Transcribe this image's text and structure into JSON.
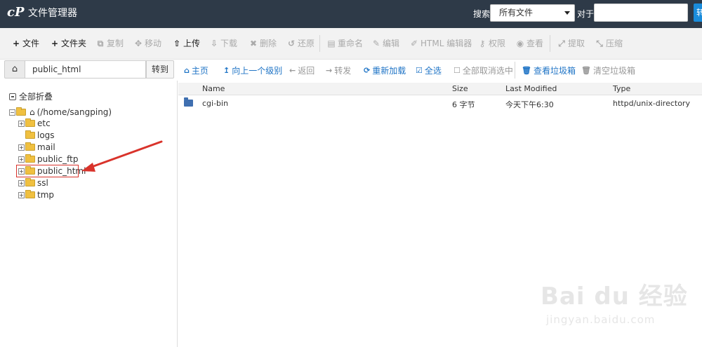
{
  "header": {
    "logo_text": "cP",
    "title": "文件管理器",
    "search_label": "搜索",
    "search_scope": "所有文件",
    "for_label": "对于",
    "search_value": "",
    "go_label": "转"
  },
  "toolbar": {
    "items": [
      {
        "label": "文件",
        "icon": "plus-icon",
        "enabled": true
      },
      {
        "label": "文件夹",
        "icon": "plus-icon",
        "enabled": true
      },
      {
        "label": "复制",
        "icon": "copy-icon",
        "enabled": false
      },
      {
        "label": "移动",
        "icon": "move-icon",
        "enabled": false
      },
      {
        "label": "上传",
        "icon": "upload-icon",
        "enabled": true
      },
      {
        "label": "下载",
        "icon": "download-icon",
        "enabled": false
      },
      {
        "label": "删除",
        "icon": "delete-icon",
        "enabled": false
      },
      {
        "label": "还原",
        "icon": "restore-icon",
        "enabled": false
      },
      {
        "label": "重命名",
        "icon": "rename-icon",
        "enabled": false
      },
      {
        "label": "编辑",
        "icon": "pencil-icon",
        "enabled": false
      },
      {
        "label": "HTML 编辑器",
        "icon": "html-editor-icon",
        "enabled": false
      },
      {
        "label": "权限",
        "icon": "key-icon",
        "enabled": false
      },
      {
        "label": "查看",
        "icon": "eye-icon",
        "enabled": false
      },
      {
        "label": "提取",
        "icon": "extract-icon",
        "enabled": false
      },
      {
        "label": "压缩",
        "icon": "compress-icon",
        "enabled": false
      }
    ]
  },
  "pathbar": {
    "path_value": "public_html",
    "goto_label": "转到"
  },
  "nav": {
    "items": [
      {
        "label": "主页",
        "icon": "home-icon",
        "enabled": true
      },
      {
        "label": "向上一个级别",
        "icon": "level-up-icon",
        "enabled": true
      },
      {
        "label": "返回",
        "icon": "back-icon",
        "enabled": false
      },
      {
        "label": "转发",
        "icon": "forward-icon",
        "enabled": false
      },
      {
        "label": "重新加载",
        "icon": "reload-icon",
        "enabled": true
      },
      {
        "label": "全选",
        "icon": "check-square-icon",
        "enabled": true
      },
      {
        "label": "全部取消选中",
        "icon": "square-icon",
        "enabled": false
      },
      {
        "label": "查看垃圾箱",
        "icon": "trash-icon",
        "enabled": true
      },
      {
        "label": "清空垃圾箱",
        "icon": "trash-icon",
        "enabled": false
      }
    ]
  },
  "tree": {
    "collapse_all": "全部折叠",
    "root": "(/home/sangping)",
    "children": [
      {
        "name": "etc",
        "expandable": true
      },
      {
        "name": "logs",
        "expandable": false
      },
      {
        "name": "mail",
        "expandable": true
      },
      {
        "name": "public_ftp",
        "expandable": true
      },
      {
        "name": "public_html",
        "expandable": true,
        "highlighted": true
      },
      {
        "name": "ssl",
        "expandable": true
      },
      {
        "name": "tmp",
        "expandable": true
      }
    ]
  },
  "table": {
    "headers": [
      "Name",
      "Size",
      "Last Modified",
      "Type"
    ],
    "rows": [
      {
        "name": "cgi-bin",
        "size": "6 字节",
        "modified": "今天下午6:30",
        "type": "httpd/unix-directory"
      }
    ]
  },
  "watermark": {
    "main": "Bai du 经验",
    "sub": "jingyan.baidu.com"
  },
  "colors": {
    "header_bg": "#2e3a48",
    "accent_blue": "#1a8cdb",
    "link_blue": "#1f74c6",
    "highlight_red": "#d9332b"
  }
}
